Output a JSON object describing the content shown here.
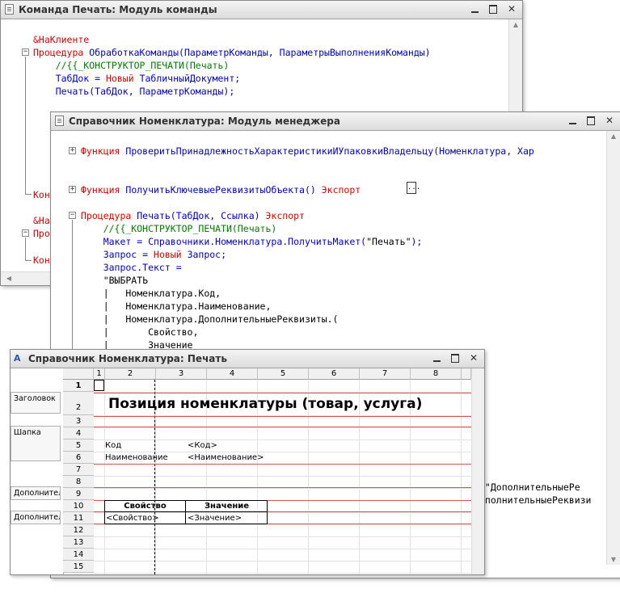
{
  "window1": {
    "title": "Команда Печать: Модуль команды",
    "lines": [
      {
        "parts": [
          {
            "t": "&НаКлиенте",
            "c": "k"
          }
        ]
      },
      {
        "parts": [
          {
            "t": "Процедура ",
            "c": "k"
          },
          {
            "t": "ОбработкаКоманды(ПараметрКоманды, ПараметрыВыполненияКоманды)",
            "c": "f"
          }
        ]
      },
      {
        "parts": [
          {
            "t": "    //{{_КОНСТРУКТОР_ПЕЧАТИ(Печать)",
            "c": "c"
          }
        ]
      },
      {
        "parts": [
          {
            "t": "    ТабДок = ",
            "c": "f"
          },
          {
            "t": "Новый ",
            "c": "k"
          },
          {
            "t": "ТабличныйДокумент;",
            "c": "f"
          }
        ]
      },
      {
        "parts": [
          {
            "t": "    Печать(ТабДок, ПараметрКоманды);",
            "c": "f"
          }
        ]
      }
    ],
    "fragment_konec1": "Кон",
    "fragment_naklient": "&НаК",
    "fragment_proc": "Про",
    "fragment_konec2": "Кон"
  },
  "window2": {
    "title": "Справочник Номенклатура: Модуль менеджера",
    "lines": [
      {
        "parts": [
          {
            "t": "Функция ",
            "c": "k"
          },
          {
            "t": "ПроверитьПринадлежностьХарактеристикиИУпаковкиВладельцу(Номенклатура, Хар",
            "c": "f"
          }
        ]
      },
      {
        "parts": []
      },
      {
        "parts": []
      },
      {
        "parts": [
          {
            "t": "Функция ",
            "c": "k"
          },
          {
            "t": "ПолучитьКлючевыеРеквизитыОбъекта() ",
            "c": "f"
          },
          {
            "t": "Экспорт",
            "c": "k"
          }
        ]
      },
      {
        "parts": []
      },
      {
        "parts": [
          {
            "t": "Процедура ",
            "c": "k"
          },
          {
            "t": "Печать(ТабДок, Ссылка) ",
            "c": "f"
          },
          {
            "t": "Экспорт",
            "c": "k"
          }
        ]
      },
      {
        "parts": [
          {
            "t": "    //{{_КОНСТРУКТОР_ПЕЧАТИ(Печать)",
            "c": "c"
          }
        ]
      },
      {
        "parts": [
          {
            "t": "    Макет = Справочники.Номенклатура.ПолучитьМакет(",
            "c": "f"
          },
          {
            "t": "\"Печать\"",
            "c": "t"
          },
          {
            "t": ");",
            "c": "f"
          }
        ]
      },
      {
        "parts": [
          {
            "t": "    Запрос = ",
            "c": "f"
          },
          {
            "t": "Новый ",
            "c": "k"
          },
          {
            "t": "Запрос;",
            "c": "f"
          }
        ]
      },
      {
        "parts": [
          {
            "t": "    Запрос.Текст =",
            "c": "f"
          }
        ]
      },
      {
        "parts": [
          {
            "t": "    \"ВЫБРАТЬ",
            "c": "t"
          }
        ]
      },
      {
        "parts": [
          {
            "t": "    |   Номенклатура.Код,",
            "c": "t"
          }
        ]
      },
      {
        "parts": [
          {
            "t": "    |   Номенклатура.Наименование,",
            "c": "t"
          }
        ]
      },
      {
        "parts": [
          {
            "t": "    |   Номенклатура.ДополнительныеРеквизиты.(",
            "c": "t"
          }
        ]
      },
      {
        "parts": [
          {
            "t": "    |       Свойство,",
            "c": "t"
          }
        ]
      },
      {
        "parts": [
          {
            "t": "    |       Значение",
            "c": "t"
          }
        ]
      }
    ],
    "right_frag1": "(\"ДополнительныеРе",
    "right_frag2": "ополнительныеРеквизи",
    "ellipsis": "..."
  },
  "window3": {
    "title": "Справочник Номенклатура: Печать",
    "columns": [
      "1",
      "2",
      "3",
      "4",
      "5",
      "6",
      "7",
      "8"
    ],
    "rows": [
      "1",
      "2",
      "3",
      "4",
      "5",
      "6",
      "7",
      "8",
      "9",
      "10",
      "11",
      "12",
      "13",
      "14",
      "15"
    ],
    "groups": {
      "zagolovok": "Заголовок",
      "shapka": "Шапка",
      "dop1": "Дополнител",
      "dop2": "Дополнител"
    },
    "heading": "Позиция номенклатуры (товар, услуга)",
    "kod_label": "Код",
    "kod_param": "<Код>",
    "naim_label": "Наименование",
    "naim_param": "<Наименование>",
    "th_svoistvo": "Свойство",
    "th_znachenie": "Значение",
    "svoistvo_param": "<Свойство>",
    "znachenie_param": "<Значение>"
  }
}
